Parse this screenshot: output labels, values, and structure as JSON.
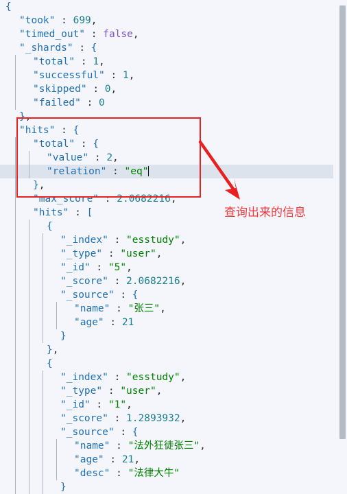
{
  "editor": {
    "language": "json",
    "background_color": "#f4f6fb",
    "highlight_color": "#dde3ec",
    "indent_guide_color": "#aab2c0",
    "colors": {
      "key": "#1f6fb4",
      "string": "#008000",
      "number": "#1a7f8e",
      "keyword": "#7a52cc",
      "punctuation": "#2b2b2b"
    },
    "lines": [
      {
        "indent": 0,
        "text": "{"
      },
      {
        "indent": 1,
        "text": "\"took\" : 699,"
      },
      {
        "indent": 1,
        "text": "\"timed_out\" : false,"
      },
      {
        "indent": 1,
        "text": "\"_shards\" : {"
      },
      {
        "indent": 2,
        "text": "\"total\" : 1,"
      },
      {
        "indent": 2,
        "text": "\"successful\" : 1,"
      },
      {
        "indent": 2,
        "text": "\"skipped\" : 0,"
      },
      {
        "indent": 2,
        "text": "\"failed\" : 0"
      },
      {
        "indent": 1,
        "text": "},"
      },
      {
        "indent": 1,
        "text": "\"hits\" : {"
      },
      {
        "indent": 2,
        "text": "\"total\" : {"
      },
      {
        "indent": 3,
        "text": "\"value\" : 2,"
      },
      {
        "indent": 3,
        "text": "\"relation\" : \"eq\""
      },
      {
        "indent": 2,
        "text": "},"
      },
      {
        "indent": 2,
        "text": "\"max_score\" : 2.0682216,"
      },
      {
        "indent": 2,
        "text": "\"hits\" : ["
      },
      {
        "indent": 3,
        "text": "{"
      },
      {
        "indent": 4,
        "text": "\"_index\" : \"esstudy\","
      },
      {
        "indent": 4,
        "text": "\"_type\" : \"user\","
      },
      {
        "indent": 4,
        "text": "\"_id\" : \"5\","
      },
      {
        "indent": 4,
        "text": "\"_score\" : 2.0682216,"
      },
      {
        "indent": 4,
        "text": "\"_source\" : {"
      },
      {
        "indent": 5,
        "text": "\"name\" : \"张三\","
      },
      {
        "indent": 5,
        "text": "\"age\" : 21"
      },
      {
        "indent": 4,
        "text": "}"
      },
      {
        "indent": 3,
        "text": "},"
      },
      {
        "indent": 3,
        "text": "{"
      },
      {
        "indent": 4,
        "text": "\"_index\" : \"esstudy\","
      },
      {
        "indent": 4,
        "text": "\"_type\" : \"user\","
      },
      {
        "indent": 4,
        "text": "\"_id\" : \"1\","
      },
      {
        "indent": 4,
        "text": "\"_score\" : 1.2893932,"
      },
      {
        "indent": 4,
        "text": "\"_source\" : {"
      },
      {
        "indent": 5,
        "text": "\"name\" : \"法外狂徒张三\","
      },
      {
        "indent": 5,
        "text": "\"age\" : 21,"
      },
      {
        "indent": 5,
        "text": "\"desc\" : \"法律大牛\""
      },
      {
        "indent": 4,
        "text": "}"
      }
    ],
    "highlighted_line_index": 12,
    "caret_line_index": 12
  },
  "response_values": {
    "took": 699,
    "timed_out": "false",
    "_shards": {
      "total": 1,
      "successful": 1,
      "skipped": 0,
      "failed": 0
    },
    "hits": {
      "total": {
        "value": 2,
        "relation": "eq"
      },
      "max_score": 2.0682216,
      "hits": [
        {
          "_index": "esstudy",
          "_type": "user",
          "_id": "5",
          "_score": 2.0682216,
          "_source": {
            "name": "张三",
            "age": 21
          }
        },
        {
          "_index": "esstudy",
          "_type": "user",
          "_id": "1",
          "_score": 1.2893932,
          "_source": {
            "name": "法外狂徒张三",
            "age": 21,
            "desc": "法律大牛"
          }
        }
      ]
    }
  },
  "annotations": {
    "label": "查询出来的信息",
    "label_color": "#ef3b3b",
    "box_color": "#e8201f",
    "arrow_color": "#e8201f"
  },
  "scrollbar": {
    "orientation": "vertical",
    "thumb_color": "#b3bcc6",
    "track_color": "#f4f6fb"
  }
}
